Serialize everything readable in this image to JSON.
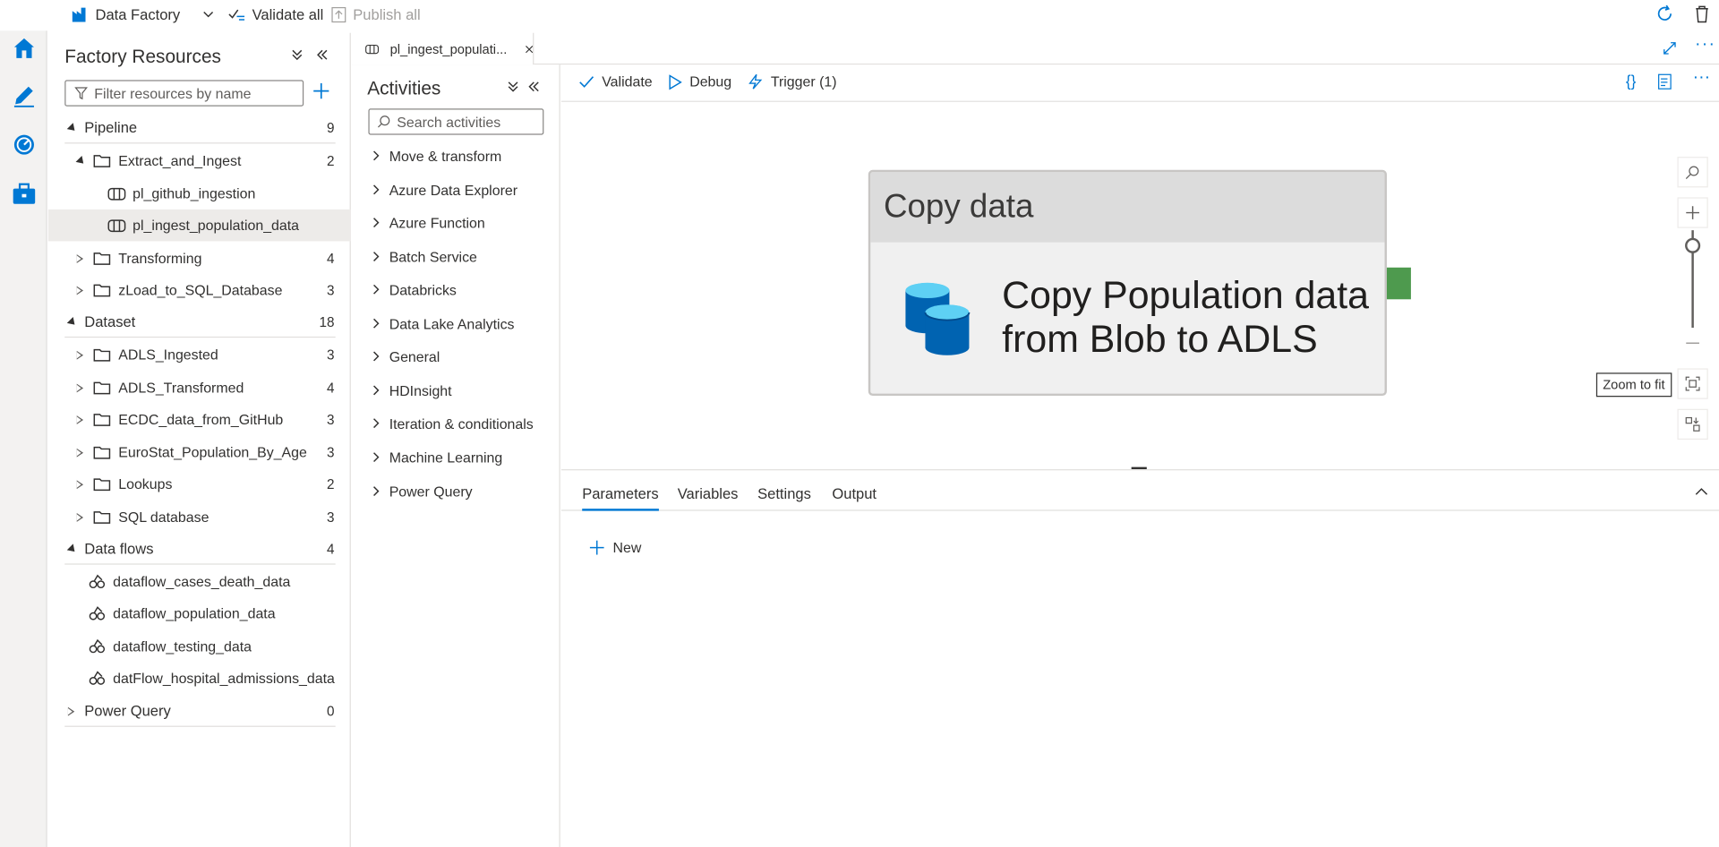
{
  "topbar": {
    "factory_label": "Data Factory",
    "validate_all": "Validate all",
    "publish_all": "Publish all"
  },
  "resources": {
    "title": "Factory Resources",
    "filter_placeholder": "Filter resources by name",
    "pipeline": {
      "label": "Pipeline",
      "count": "9"
    },
    "pipeline_items": [
      {
        "label": "Extract_and_Ingest",
        "count": "2"
      },
      {
        "label": "pl_github_ingestion"
      },
      {
        "label": "pl_ingest_population_data"
      },
      {
        "label": "Transforming",
        "count": "4"
      },
      {
        "label": "zLoad_to_SQL_Database",
        "count": "3"
      }
    ],
    "dataset": {
      "label": "Dataset",
      "count": "18"
    },
    "dataset_items": [
      {
        "label": "ADLS_Ingested",
        "count": "3"
      },
      {
        "label": "ADLS_Transformed",
        "count": "4"
      },
      {
        "label": "ECDC_data_from_GitHub",
        "count": "3"
      },
      {
        "label": "EuroStat_Population_By_Age",
        "count": "3"
      },
      {
        "label": "Lookups",
        "count": "2"
      },
      {
        "label": "SQL database",
        "count": "3"
      }
    ],
    "dataflows": {
      "label": "Data flows",
      "count": "4"
    },
    "dataflow_items": [
      {
        "label": "dataflow_cases_death_data"
      },
      {
        "label": "dataflow_population_data"
      },
      {
        "label": "dataflow_testing_data"
      },
      {
        "label": "datFlow_hospital_admissions_data"
      }
    ],
    "powerquery": {
      "label": "Power Query",
      "count": "0"
    }
  },
  "tab": {
    "label": "pl_ingest_populati..."
  },
  "activities": {
    "title": "Activities",
    "search_placeholder": "Search activities",
    "items": [
      "Move & transform",
      "Azure Data Explorer",
      "Azure Function",
      "Batch Service",
      "Databricks",
      "Data Lake Analytics",
      "General",
      "HDInsight",
      "Iteration & conditionals",
      "Machine Learning",
      "Power Query"
    ]
  },
  "pipeline_toolbar": {
    "validate": "Validate",
    "debug": "Debug",
    "trigger": "Trigger (1)"
  },
  "canvas": {
    "activity_type": "Copy data",
    "activity_name": "Copy Population data from Blob to ADLS",
    "zoom_tooltip": "Zoom to fit",
    "zoom_level": 0.85
  },
  "bottom": {
    "tabs": [
      "Parameters",
      "Variables",
      "Settings",
      "Output"
    ],
    "new_label": "New"
  },
  "colors": {
    "accent": "#0078d4",
    "output_port": "#4e9a4e"
  }
}
